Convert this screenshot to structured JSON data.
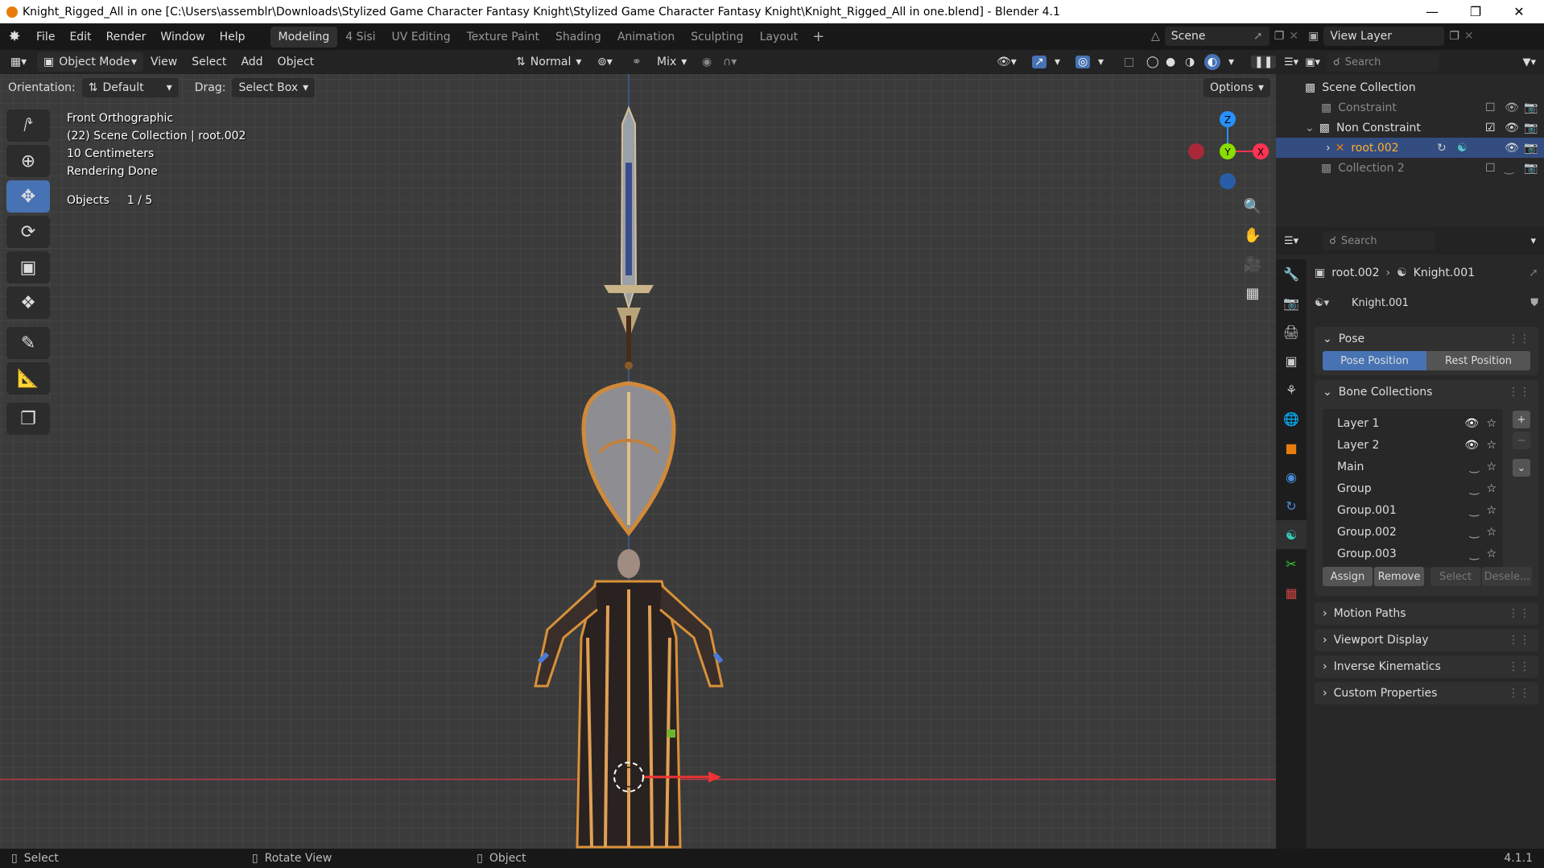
{
  "window": {
    "title": "Knight_Rigged_All in one [C:\\Users\\assemblr\\Downloads\\Stylized Game Character Fantasy Knight\\Stylized Game Character Fantasy Knight\\Knight_Rigged_All in one.blend] - Blender 4.1"
  },
  "menu": [
    "File",
    "Edit",
    "Render",
    "Window",
    "Help"
  ],
  "workspaces": [
    "Modeling",
    "4 Sisi",
    "UV Editing",
    "Texture Paint",
    "Shading",
    "Animation",
    "Sculpting",
    "Layout"
  ],
  "scene": {
    "name": "Scene",
    "view_layer": "View Layer"
  },
  "header": {
    "mode": "Object Mode",
    "view": "View",
    "select": "Select",
    "add": "Add",
    "object": "Object",
    "transform_orientation": "Normal",
    "blend": "Mix"
  },
  "header2": {
    "orientation_label": "Orientation:",
    "orientation_value": "Default",
    "drag_label": "Drag:",
    "drag_value": "Select Box",
    "options": "Options"
  },
  "viewport_info": {
    "view": "Front Orthographic",
    "collection": "(22) Scene Collection | root.002",
    "scale": "10 Centimeters",
    "render": "Rendering Done",
    "objects_label": "Objects",
    "objects_value": "1 / 5"
  },
  "gizmo": {
    "z": "Z",
    "y": "Y",
    "x": "X"
  },
  "outliner": {
    "search_placeholder": "Search",
    "root": "Scene Collection",
    "items": [
      {
        "label": "Constraint"
      },
      {
        "label": "Non Constraint"
      },
      {
        "label": "root.002"
      },
      {
        "label": "Collection 2"
      }
    ]
  },
  "properties": {
    "search_placeholder": "Search",
    "breadcrumb_object": "root.002",
    "breadcrumb_data": "Knight.001",
    "data_name": "Knight.001",
    "pose_panel": "Pose",
    "pose_position": "Pose Position",
    "rest_position": "Rest Position",
    "bone_collections_panel": "Bone Collections",
    "bone_collections": [
      "Layer 1",
      "Layer 2",
      "Main",
      "Group",
      "Group.001",
      "Group.002",
      "Group.003"
    ],
    "assign": "Assign",
    "remove": "Remove",
    "select": "Select",
    "deselect": "Desele...",
    "collapsed_panels": [
      "Motion Paths",
      "Viewport Display",
      "Inverse Kinematics",
      "Custom Properties"
    ]
  },
  "status": {
    "left": "Select",
    "middle": "Rotate View",
    "right": "Object",
    "version": "4.1.1"
  },
  "colors": {
    "accent": "#4772b3",
    "x_axis": "#ff3352",
    "y_axis": "#8bdc00",
    "z_axis": "#2890ff",
    "selected": "#e87d0d"
  }
}
